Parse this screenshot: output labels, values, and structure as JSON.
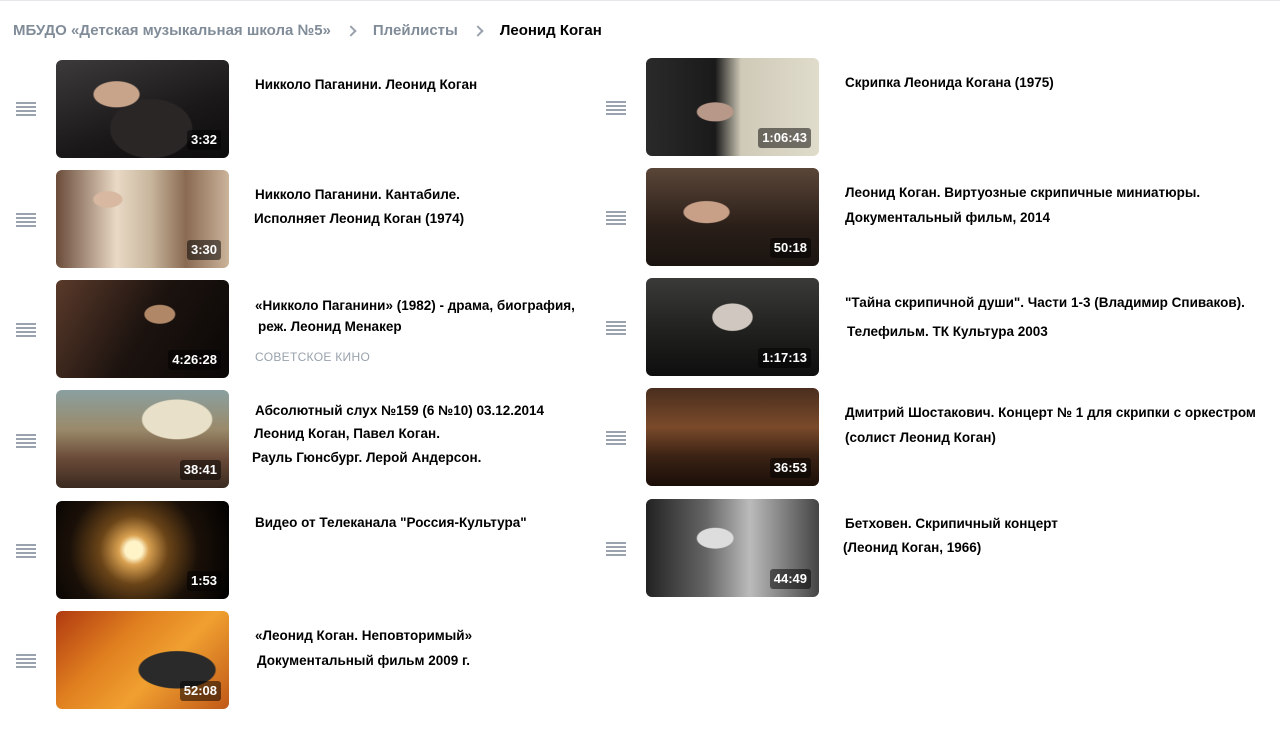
{
  "breadcrumb": {
    "items": [
      "МБУДО «Детская музыкальная школа №5»",
      "Плейлисты"
    ],
    "current": "Леонид Коган"
  },
  "left_column": [
    {
      "title": [
        "Никколо Паганини. Леонид Коган"
      ],
      "duration": "3:32"
    },
    {
      "title": [
        "Никколо Паганини. Кантабиле.",
        "Исполняет Леонид Коган (1974)"
      ],
      "duration": "3:30"
    },
    {
      "title": [
        "«Никколо Паганини» (1982) - драма, биография,",
        "реж. Леонид Менакер"
      ],
      "subtitle": "СОВЕТСКОЕ КИНО",
      "duration": "4:26:28"
    },
    {
      "title": [
        "Абсолютный слух №159 (6 №10) 03.12.2014",
        "Леонид Коган, Павел Коган.",
        "Рауль Гюнсбург. Лерой Андерсон."
      ],
      "duration": "38:41"
    },
    {
      "title": [
        "Видео от Телеканала \"Россия-Культура\""
      ],
      "duration": "1:53"
    },
    {
      "title": [
        "«Леонид Коган. Неповторимый»",
        "Документальный фильм 2009 г."
      ],
      "duration": "52:08"
    }
  ],
  "right_column": [
    {
      "title": [
        "Скрипка Леонида Когана (1975)"
      ],
      "duration": "1:06:43"
    },
    {
      "title": [
        "Леонид Коган. Виртуозные скрипичные миниатюры.",
        "Документальный фильм, 2014"
      ],
      "duration": "50:18"
    },
    {
      "title": [
        "\"Тайна скрипичной души\". Части 1-3 (Владимир Спиваков).",
        "Телефильм. ТК Культура 2003"
      ],
      "duration": "1:17:13"
    },
    {
      "title": [
        "Дмитрий Шостакович. Концерт № 1 для скрипки с оркестром",
        "(солист Леонид Коган)"
      ],
      "duration": "36:53"
    },
    {
      "title": [
        "Бетховен. Скрипичный концерт",
        "(Леонид Коган, 1966)"
      ],
      "duration": "44:49"
    }
  ],
  "colors": {
    "link_gray": "#818c99",
    "drag_icon": "#99a2ad",
    "text": "#000000"
  },
  "icons": {
    "separator": "chevron-right-icon",
    "drag": "drag-handle-icon"
  }
}
